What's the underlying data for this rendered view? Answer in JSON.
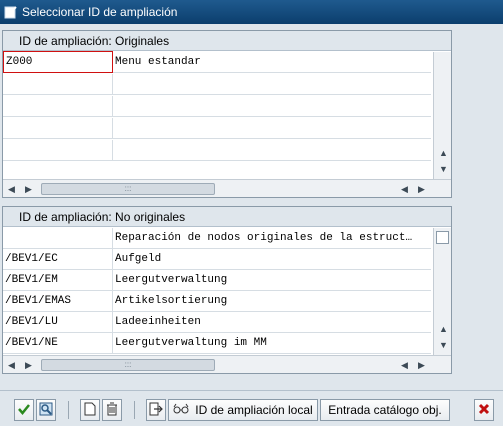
{
  "window": {
    "title": "Seleccionar ID de ampliación"
  },
  "originals": {
    "header": "ID de ampliación: Originales",
    "rows": [
      {
        "id": "Z000",
        "text": "Menu estandar"
      },
      {
        "id": "",
        "text": ""
      },
      {
        "id": "",
        "text": ""
      },
      {
        "id": "",
        "text": ""
      },
      {
        "id": "",
        "text": ""
      }
    ]
  },
  "non_originals": {
    "header": "ID de ampliación: No originales",
    "rows": [
      {
        "id": "",
        "text": "Reparación de nodos originales de la estruct…"
      },
      {
        "id": "/BEV1/EC",
        "text": "Aufgeld"
      },
      {
        "id": "/BEV1/EM",
        "text": "Leergutverwaltung"
      },
      {
        "id": "/BEV1/EMAS",
        "text": "Artikelsortierung"
      },
      {
        "id": "/BEV1/LU",
        "text": "Ladeeinheiten"
      },
      {
        "id": "/BEV1/NE",
        "text": "Leergutverwaltung im MM"
      }
    ]
  },
  "footer": {
    "local_id_label": "ID de ampliación local",
    "catalog_label": "Entrada catálogo obj."
  },
  "icons": {
    "title": "window-edit-icon",
    "confirm": "check-icon",
    "search": "search-icon",
    "new": "new-document-icon",
    "delete": "trash-icon",
    "transfer": "transfer-icon",
    "glasses": "glasses-icon",
    "cancel": "cancel-icon"
  },
  "colors": {
    "titlebar": "#0b3e6d",
    "confirm_green": "#2b8a1f",
    "cancel_red": "#c01010",
    "selection_red": "#d01010"
  }
}
